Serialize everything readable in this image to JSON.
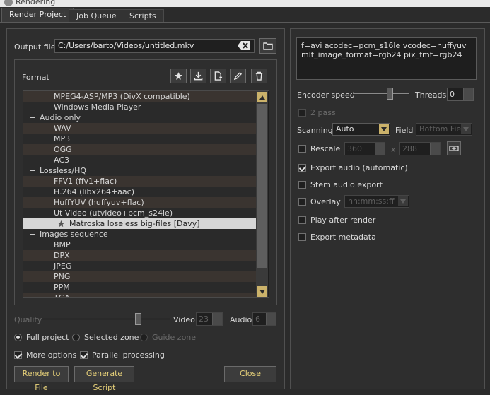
{
  "window": {
    "title": "Rendering"
  },
  "tabs": [
    {
      "label": "Render Project",
      "active": true
    },
    {
      "label": "Job Queue",
      "active": false
    },
    {
      "label": "Scripts",
      "active": false
    }
  ],
  "output": {
    "label": "Output file",
    "value": "C:/Users/barto/Videos/untitled.mkv"
  },
  "format": {
    "label": "Format",
    "items": [
      {
        "type": "item",
        "label": "MPEG4-ASP/MP3 (DivX compatible)"
      },
      {
        "type": "item",
        "label": "Windows Media Player"
      },
      {
        "type": "category",
        "label": "Audio only"
      },
      {
        "type": "item",
        "label": "WAV"
      },
      {
        "type": "item",
        "label": "MP3"
      },
      {
        "type": "item",
        "label": "OGG"
      },
      {
        "type": "item",
        "label": "AC3"
      },
      {
        "type": "category",
        "label": "Lossless/HQ"
      },
      {
        "type": "item",
        "label": "FFV1 (ffv1+flac)"
      },
      {
        "type": "item",
        "label": "H.264 (libx264+aac)"
      },
      {
        "type": "item",
        "label": "HuffYUV (huffyuv+flac)"
      },
      {
        "type": "item",
        "label": "Ut Video (utvideo+pcm_s24le)"
      },
      {
        "type": "selected",
        "label": "Matroska loseless big-files [Davy]"
      },
      {
        "type": "category",
        "label": "Images sequence"
      },
      {
        "type": "item",
        "label": "BMP"
      },
      {
        "type": "item",
        "label": "DPX"
      },
      {
        "type": "item",
        "label": "JPEG"
      },
      {
        "type": "item",
        "label": "PNG"
      },
      {
        "type": "item",
        "label": "PPM"
      },
      {
        "type": "item",
        "label": "TGA"
      }
    ]
  },
  "quality": {
    "label": "Quality",
    "slider_level": 0.75,
    "video_label": "Video",
    "video_value": "23",
    "audio_label": "Audio",
    "audio_value": "6"
  },
  "zone": {
    "full_project": "Full project",
    "selected_zone": "Selected zone",
    "guide_zone": "Guide zone"
  },
  "options": {
    "more_options": "More options",
    "parallel": "Parallel processing"
  },
  "buttons": {
    "render": "Render to File",
    "script": "Generate Script",
    "close": "Close"
  },
  "params": {
    "text": "f=avi acodec=pcm_s16le vcodec=huffyuv mlt_image_format=rgb24 pix_fmt=rgb24"
  },
  "encoder": {
    "speed_label": "Encoder speed",
    "speed_level": 0.65,
    "threads_label": "Threads",
    "threads_value": "0"
  },
  "right": {
    "two_pass": "2 pass",
    "scanning_label": "Scanning",
    "scanning_value": "Auto",
    "field_label": "Field",
    "field_value": "Bottom Field",
    "rescale_label": "Rescale",
    "rescale_w": "360",
    "rescale_x": "x",
    "rescale_h": "288",
    "export_audio": "Export audio (automatic)",
    "stem_audio": "Stem audio export",
    "overlay_label": "Overlay",
    "overlay_value": "hh:mm:ss:ff",
    "play_after": "Play after render",
    "export_metadata": "Export metadata"
  },
  "colors": {
    "accent": "#cbb26a",
    "bg": "#2b2b2b",
    "selected_row": "#d6d6d6",
    "list_stripe": "#3a3430"
  }
}
